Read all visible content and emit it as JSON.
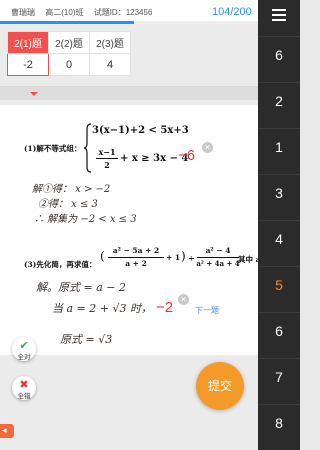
{
  "header": {
    "student": "曹瑞瑞",
    "class": "高二(10)班",
    "paper_label": "试题ID：",
    "paper_id": "123456",
    "progress": "104/200",
    "progress_fraction": 0.52
  },
  "score_table": {
    "questions": [
      "2(1)题",
      "2(2)题",
      "2(3)题"
    ],
    "scores": [
      "-2",
      "0",
      "4"
    ],
    "active_index": 0
  },
  "answer_sheet": {
    "q1": {
      "prefix": "(1)解不等式组：",
      "line1": "3(x−1)+2 < 5x+3",
      "frac_num": "x−1",
      "frac_den": "2",
      "line2_rest": "+ x ≥ 3x − 4",
      "work": [
        "解①得： x > −2",
        "②得： x ≤ 3",
        "∴ 解集为 −2 < x ≤ 3"
      ],
      "score": "−6"
    },
    "q3": {
      "prefix": "(3)先化简，再求值：",
      "f1_num": "a² − 5a + 2",
      "f1_den": "a + 2",
      "plus1": "+ 1",
      "div": "÷",
      "f2_num": "a² − 4",
      "f2_den": "a² + 4a + 4",
      "suffix": "其中 a =",
      "work": [
        "解。原式 = a − 2",
        "当 a = 2 + √3 时，",
        "原式 = √3"
      ],
      "score": "−2",
      "next_label": "下一题"
    }
  },
  "buttons": {
    "all_right": "全对",
    "all_wrong": "全错",
    "submit": "提交"
  },
  "sidebar": {
    "items": [
      "6",
      "2",
      "1",
      "3",
      "4",
      "5",
      "6",
      "7",
      "8"
    ],
    "current_index": 5,
    "current_color": "#f3892c"
  },
  "colors": {
    "accent_blue": "#2f8ef2",
    "score_red": "#e6342e",
    "submit_orange": "#f39a28"
  }
}
